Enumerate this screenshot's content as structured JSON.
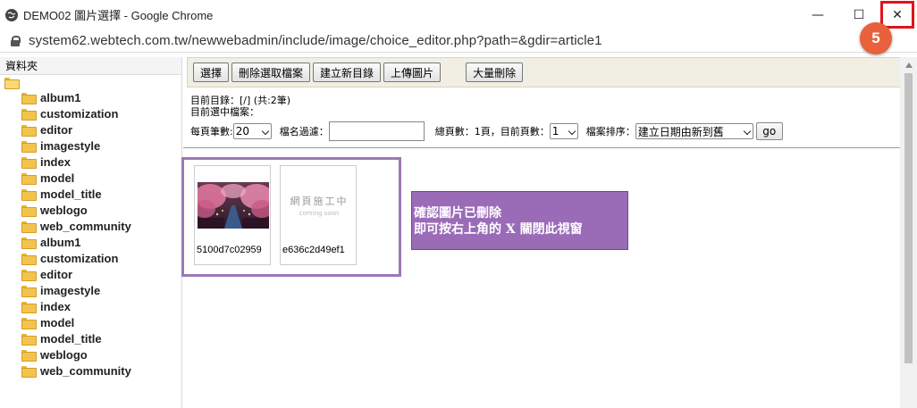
{
  "window": {
    "title": "DEMO02 圖片選擇 - Google Chrome",
    "url": "system62.webtech.com.tw/newwebadmin/include/image/choice_editor.php?path=&gdir=article1",
    "minimize_glyph": "—",
    "maximize_glyph": "☐",
    "close_glyph": "✕"
  },
  "step_badge": "5",
  "tree": {
    "header": "資料夾",
    "folders": [
      "album1",
      "customization",
      "editor",
      "imagestyle",
      "index",
      "model",
      "model_title",
      "weblogo",
      "web_community",
      "album1",
      "customization",
      "editor",
      "imagestyle",
      "index",
      "model",
      "model_title",
      "weblogo",
      "web_community"
    ]
  },
  "toolbar": {
    "select": "選擇",
    "delete_selected": "刪除選取檔案",
    "new_dir": "建立新目錄",
    "upload": "上傳圖片",
    "bulk_delete": "大量刪除"
  },
  "info": {
    "current_dir": "目前目錄：[/] (共:2筆)",
    "selected_file": "目前選中檔案："
  },
  "controls": {
    "per_page_label": "每頁筆數:",
    "per_page_value": "20",
    "filter_label": "檔名過濾：",
    "filter_value": "",
    "total_pages": "總頁數：1頁，目前頁數：",
    "current_page": "1",
    "sort_label": "檔案排序：",
    "sort_value": "建立日期由新到舊",
    "go": "go"
  },
  "thumbnails": [
    {
      "name": "5100d7c02959"
    },
    {
      "name": "e636c2d49ef1",
      "placeholder_big": "網頁施工中",
      "placeholder_small": "coming soon"
    }
  ],
  "note": {
    "line1": "確認圖片已刪除",
    "line2": "即可按右上角的 X 關閉此視窗"
  },
  "colors": {
    "accent_purple": "#9a6cb8",
    "badge_orange": "#e8603c",
    "highlight_red": "#e0141e"
  }
}
